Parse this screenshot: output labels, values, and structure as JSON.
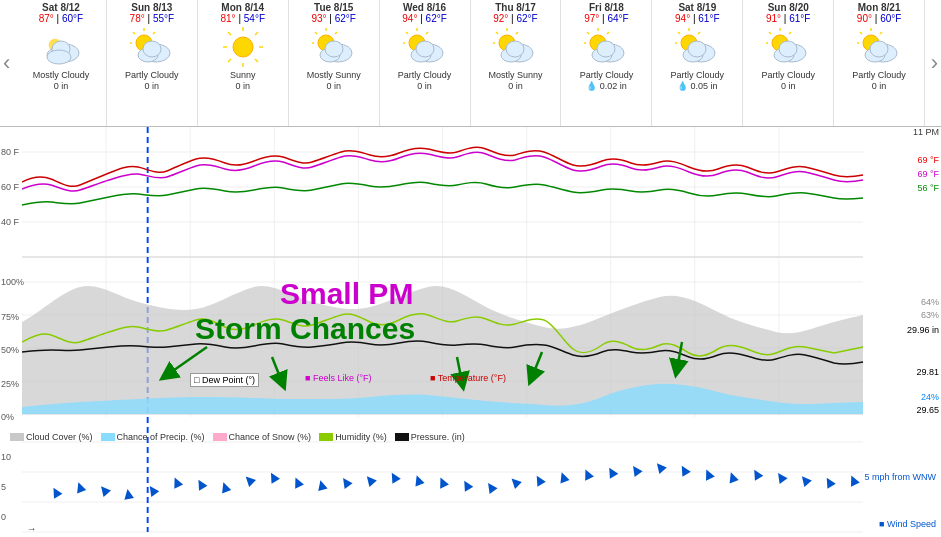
{
  "days": [
    {
      "header": "Sat 8/12",
      "hi": "87°",
      "lo": "60°F",
      "icon": "mostly_cloudy",
      "desc": "Mostly Cloudy",
      "precip": "0 in"
    },
    {
      "header": "Sun 8/13",
      "hi": "78°",
      "lo": "55°F",
      "icon": "partly_cloudy",
      "desc": "Partly Cloudy",
      "precip": "0 in"
    },
    {
      "header": "Mon 8/14",
      "hi": "81°",
      "lo": "54°F",
      "icon": "sunny",
      "desc": "Sunny",
      "precip": "0 in"
    },
    {
      "header": "Tue 8/15",
      "hi": "93°",
      "lo": "62°F",
      "icon": "mostly_sunny",
      "desc": "Mostly Sunny",
      "precip": "0 in"
    },
    {
      "header": "Wed 8/16",
      "hi": "94°",
      "lo": "62°F",
      "icon": "partly_cloudy",
      "desc": "Partly Cloudy",
      "precip": "0 in"
    },
    {
      "header": "Thu 8/17",
      "hi": "92°",
      "lo": "62°F",
      "icon": "mostly_sunny",
      "desc": "Mostly Sunny",
      "precip": "0 in"
    },
    {
      "header": "Fri 8/18",
      "hi": "97°",
      "lo": "64°F",
      "icon": "partly_cloudy",
      "desc": "Partly Cloudy",
      "precip": "0.02 in"
    },
    {
      "header": "Sat 8/19",
      "hi": "94°",
      "lo": "61°F",
      "icon": "partly_cloudy",
      "desc": "Partly Cloudy",
      "precip": "0.05 in"
    },
    {
      "header": "Sun 8/20",
      "hi": "91°",
      "lo": "61°F",
      "icon": "partly_cloudy",
      "desc": "Partly Cloudy",
      "precip": "0 in"
    },
    {
      "header": "Mon 8/21",
      "hi": "90°",
      "lo": "60°F",
      "icon": "partly_cloudy",
      "desc": "Partly Cloudy",
      "precip": "0 in"
    }
  ],
  "chart": {
    "time_label": "11 PM",
    "right_values": {
      "temp_69_1": "69 °F",
      "temp_69_2": "69 °F",
      "temp_56": "56 °F",
      "pct_64": "64%",
      "pct_63": "63%",
      "pressure_2996": "29.96 in",
      "pressure_2981": "29.81",
      "pct_24": "24%",
      "pressure_2965": "29.65"
    },
    "axis_labels": {
      "y_80f": "80 F",
      "y_60f": "60 F",
      "y_40f": "40 F",
      "y_100pct": "100%",
      "y_75pct": "75%",
      "y_50pct": "50%",
      "y_25pct": "25%",
      "y_0pct": "0%",
      "y_10wind": "10",
      "y_5wind": "5",
      "y_0wind": "0"
    }
  },
  "annotations": {
    "small_pm": "Small PM",
    "storm_chances": "Storm Chances"
  },
  "legend": {
    "cloud_cover": "Cloud Cover (%)",
    "chance_precip": "Chance of Precip. (%)",
    "chance_snow": "Chance of Snow (%)",
    "humidity": "Humidity (%)",
    "pressure": "Pressure. (in)",
    "dew_point": "Dew Point (°)",
    "feels_like": "Feels Like (°F)",
    "temperature": "Temperature (°F)",
    "wind_speed": "Wind Speed",
    "wind_value": "5 mph from WNW"
  },
  "nav": {
    "left_arrow": "‹",
    "right_arrow": "›"
  }
}
